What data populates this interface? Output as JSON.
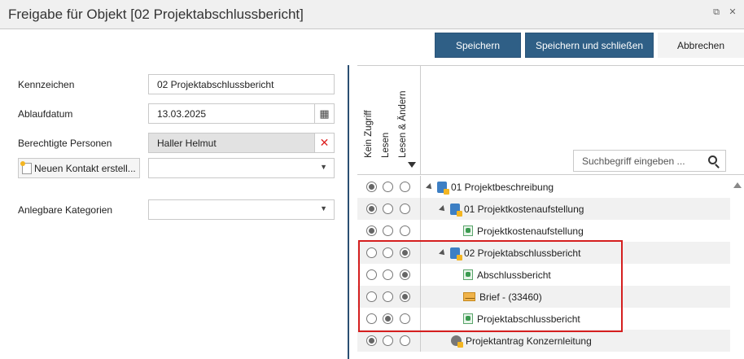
{
  "window": {
    "title": "Freigabe für Objekt [02 Projektabschlussbericht]"
  },
  "toolbar": {
    "save_label": "Speichern",
    "save_close_label": "Speichern und schließen",
    "cancel_label": "Abbrechen"
  },
  "form": {
    "kennzeichen_label": "Kennzeichen",
    "kennzeichen_value": "02 Projektabschlussbericht",
    "ablaufdatum_label": "Ablaufdatum",
    "ablaufdatum_value": "13.03.2025",
    "personen_label": "Berechtigte Personen",
    "personen_value": "Haller Helmut",
    "new_contact_label": "Neuen Kontakt erstell...",
    "kategorien_label": "Anlegbare Kategorien"
  },
  "permissions": {
    "col_none": "Kein Zugriff",
    "col_read": "Lesen",
    "col_edit": "Lesen & Ändern",
    "search_placeholder": "Suchbegriff eingeben ...",
    "rows": [
      {
        "label": "01 Projektbeschreibung",
        "icon": "folder-icon",
        "selected": "none"
      },
      {
        "label": "01 Projektkostenaufstellung",
        "icon": "folder-icon",
        "selected": "none"
      },
      {
        "label": "Projektkostenaufstellung",
        "icon": "document-icon",
        "selected": "none"
      },
      {
        "label": "02 Projektabschlussbericht",
        "icon": "folder-icon",
        "selected": "edit"
      },
      {
        "label": "Abschlussbericht",
        "icon": "document-icon",
        "selected": "edit"
      },
      {
        "label": "Brief - (33460)",
        "icon": "mail-icon",
        "selected": "edit"
      },
      {
        "label": "Projektabschlussbericht",
        "icon": "document-icon",
        "selected": "read"
      },
      {
        "label": "Projektantrag Konzernleitung",
        "icon": "gear-icon",
        "selected": "none"
      }
    ]
  },
  "colors": {
    "primary": "#2f5f86",
    "divider": "#2a4e72",
    "highlight": "#d51f1f",
    "delete": "#dd2222"
  }
}
